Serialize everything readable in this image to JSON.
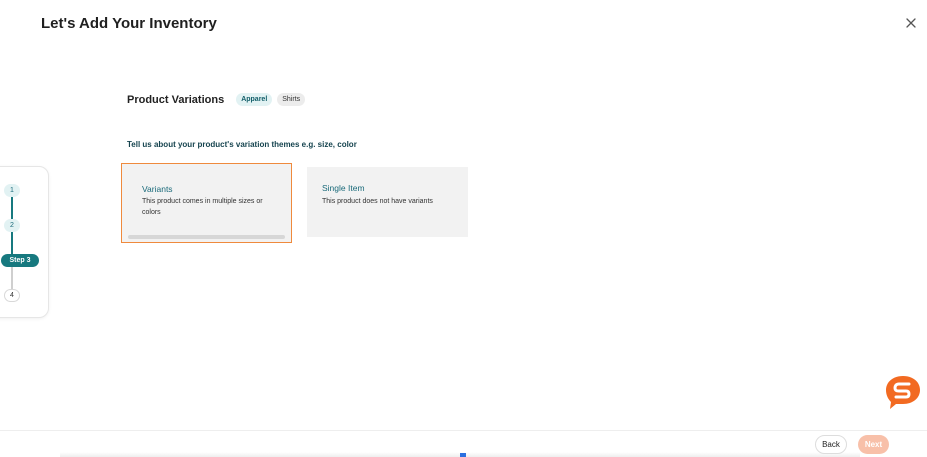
{
  "header": {
    "title": "Let's Add Your Inventory"
  },
  "section": {
    "title": "Product Variations",
    "tags": [
      "Apparel",
      "Shirts"
    ],
    "prompt": "Tell us about your product's variation themes e.g. size, color"
  },
  "options": [
    {
      "title": "Variants",
      "description": "This product comes in multiple sizes or colors",
      "selected": true
    },
    {
      "title": "Single Item",
      "description": "This product does not have variants",
      "selected": false
    }
  ],
  "stepper": {
    "steps": [
      {
        "label": "1",
        "state": "completed"
      },
      {
        "label": "2",
        "state": "completed"
      },
      {
        "label": "Step 3",
        "state": "active"
      },
      {
        "label": "4",
        "state": "upcoming"
      }
    ]
  },
  "footer": {
    "back_label": "Back",
    "next_label": "Next"
  },
  "colors": {
    "accent": "#17797f",
    "selected_border": "#ef8a3d",
    "next_disabled": "#f8c0a9",
    "chat_bubble": "#f26a21"
  },
  "icons": {
    "close": "close-icon",
    "chat": "chat-bubble-s-icon"
  }
}
